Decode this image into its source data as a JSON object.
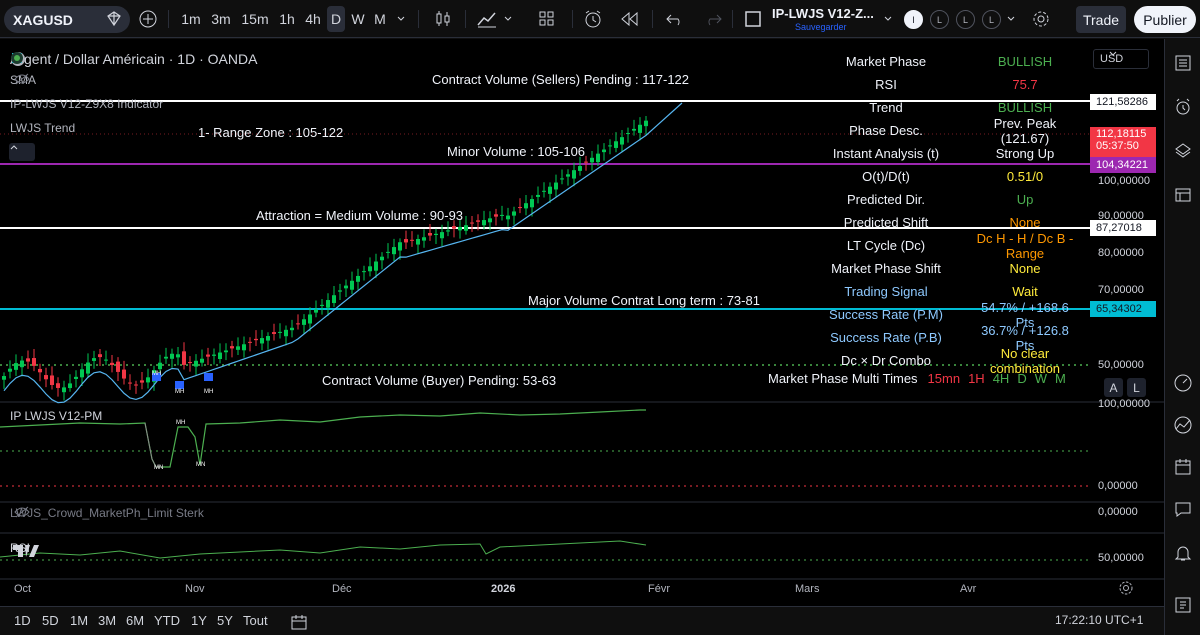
{
  "toolbar": {
    "symbol": "XAGUSD",
    "timeframes": [
      "1m",
      "3m",
      "15m",
      "1h",
      "4h",
      "D",
      "W",
      "M"
    ],
    "active_timeframe": "D",
    "layout_name": "IP-LWJS V12-Z...",
    "layout_sub": "Sauvegarder",
    "circles": [
      "I",
      "L",
      "L",
      "L"
    ],
    "trade_label": "Trade",
    "publish_label": "Publier"
  },
  "chart": {
    "title": "Argent / Dollar Américain · 1D · OANDA",
    "sma_label": "SMA",
    "indicator_label": "IP-LWJS V12-Z9X8 Indicator",
    "trend_label": "LWJS Trend",
    "pm_label": "IP LWJS V12-PM",
    "crowd_label": "LWJS_Crowd_MarketPh_Limit Sterk",
    "rsi_label": "RSI",
    "annotations": {
      "sellers": "Contract Volume (Sellers) Pending : 117-122",
      "range_zone": "1- Range Zone : 105-122",
      "minor": "Minor Volume : 105-106",
      "attraction": "Attraction = Medium Volume : 90-93",
      "major": "Major Volume Contrat Long term : 73-81",
      "buyer": "Contract Volume (Buyer) Pending: 53-63"
    },
    "mh_marks": [
      "MH",
      "MH",
      "MH",
      "MH",
      "MN",
      "MN"
    ],
    "auto_label": "A",
    "log_label": "L",
    "currency": "USD"
  },
  "price_axis": {
    "labels": [
      "100,00000",
      "90,00000",
      "80,00000",
      "70,00000",
      "50,00000",
      "100,00000",
      "0,00000",
      "0,00000",
      "50,00000"
    ],
    "tags": {
      "p121": "121,58286",
      "p112": "112,18115",
      "countdown": "05:37:50",
      "p104": "104,34221",
      "p87": "87,27018",
      "p65": "65,34302"
    }
  },
  "info_table": [
    {
      "k": "Market Phase",
      "v": "BULLISH",
      "color": "#4caf50"
    },
    {
      "k": "RSI",
      "v": "75.7",
      "color": "#f23645"
    },
    {
      "k": "Trend",
      "v": "BULLISH",
      "color": "#4caf50"
    },
    {
      "k": "Phase Desc.",
      "v": "Prev. Peak (121.67)",
      "color": "#f0f3fa"
    },
    {
      "k": "Instant Analysis (t)",
      "v": "Strong Up",
      "color": "#f0f3fa"
    },
    {
      "k": "O(t)/D(t)",
      "v": "0.51/0",
      "color": "#ffeb3b"
    },
    {
      "k": "Predicted Dir.",
      "v": "Up",
      "color": "#4caf50"
    },
    {
      "k": "Predicted Shift",
      "v": "None",
      "color": "#ff9800"
    },
    {
      "k": "LT Cycle (Dc)",
      "v": "Dc H - H / Dc B - Range",
      "color": "#ff9800"
    },
    {
      "k": "Market Phase Shift",
      "v": "None",
      "color": "#ffeb3b"
    },
    {
      "k": "Trading Signal",
      "v": "Wait",
      "color": "#ffeb3b"
    },
    {
      "k": "Success Rate (P.M)",
      "v": "54.7% / +168.6 Pts",
      "color": "#8ec9ff"
    },
    {
      "k": "Success Rate (P.B)",
      "v": "36.7% / +126.8 Pts",
      "color": "#8ec9ff"
    },
    {
      "k": "Dc × Dr Combo",
      "v": "No clear combination",
      "color": "#ffeb3b"
    }
  ],
  "multi_times": {
    "label": "Market Phase Multi Times",
    "items": [
      {
        "t": "15mn",
        "color": "#f23645"
      },
      {
        "t": "1H",
        "color": "#f23645"
      },
      {
        "t": "4H",
        "color": "#4caf50"
      },
      {
        "t": "D",
        "color": "#4caf50"
      },
      {
        "t": "W",
        "color": "#4caf50"
      },
      {
        "t": "M",
        "color": "#4caf50"
      }
    ]
  },
  "time_axis": [
    "Oct",
    "Nov",
    "Déc",
    "2026",
    "Févr",
    "Mars",
    "Avr"
  ],
  "bottom": {
    "ranges": [
      "1D",
      "5D",
      "1M",
      "3M",
      "6M",
      "YTD",
      "1Y",
      "5Y",
      "Tout"
    ],
    "clock": "17:22:10 UTC+1"
  }
}
